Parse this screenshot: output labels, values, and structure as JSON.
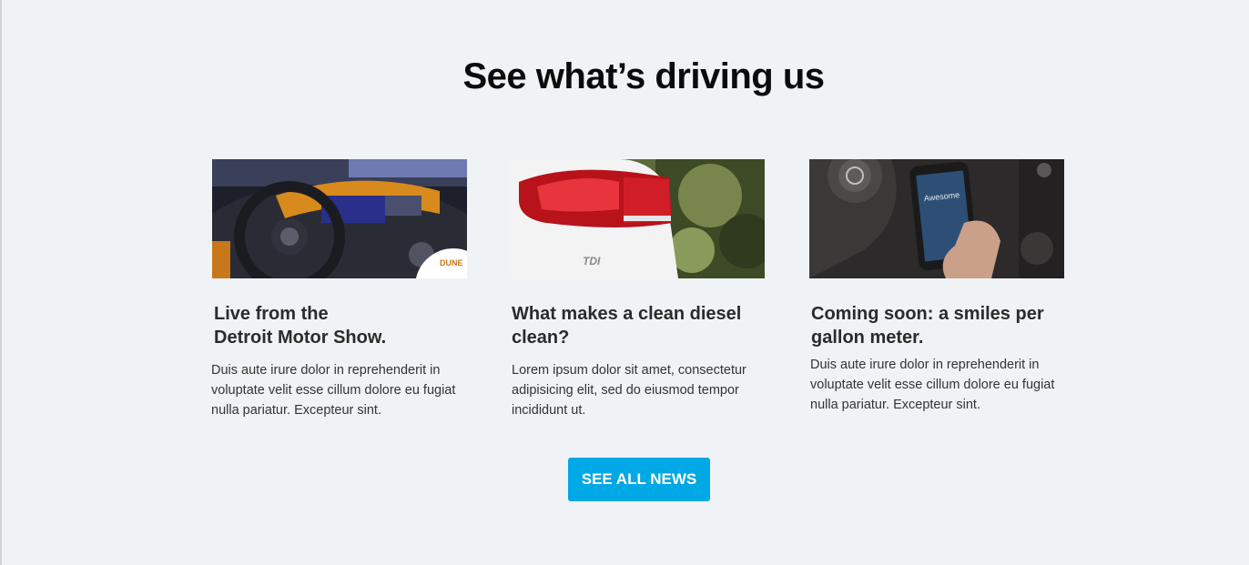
{
  "section": {
    "title": "See what’s driving us"
  },
  "cards": [
    {
      "title_line1": "Live from the",
      "title_line2": "Detroit Motor Show.",
      "body": "Duis aute irure dolor in reprehenderit in voluptate velit esse cillum dolore eu fugiat nulla pariatur. Excepteur sint.",
      "image_icon": "car-interior-image",
      "badge_text": "DUNE"
    },
    {
      "title_line1": "What makes a clean diesel",
      "title_line2": "clean?",
      "body": "Lorem ipsum dolor sit amet, consectetur adipisicing elit, sed do eiusmod tempor incididunt ut.",
      "image_icon": "tail-light-image",
      "badge_text": "TDI"
    },
    {
      "title_line1": "Coming soon: a smiles per",
      "title_line2": "gallon meter.",
      "body": "Duis aute irure dolor in reprehenderit in voluptate velit esse cillum dolore eu fugiat nulla pariatur. Excepteur sint.",
      "image_icon": "phone-in-car-image",
      "badge_text": "Awesome"
    }
  ],
  "cta": {
    "label": "SEE ALL NEWS"
  },
  "colors": {
    "background": "#f0f3f5",
    "accent": "#00a8e6",
    "heading": "#0b0b0b",
    "text": "#333333"
  }
}
